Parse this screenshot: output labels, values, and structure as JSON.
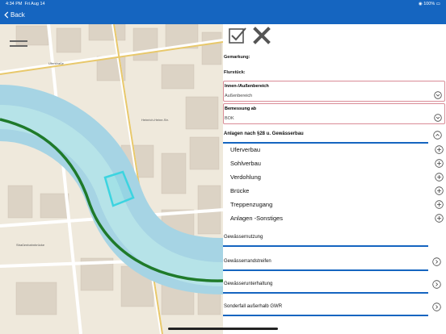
{
  "status_bar": {
    "time": "4:34 PM",
    "date": "Fri Aug 14",
    "battery": "100%"
  },
  "nav": {
    "back_label": "Back"
  },
  "map": {
    "street_labels": [
      "Uferstraße",
      "Heinrich-Heine-Str.",
      "Straßenbahnbrücke"
    ],
    "colors": {
      "river": "#a6d4e4",
      "river_band": "#b6e3e8",
      "river_outline": "#1f7a2a",
      "parcel_highlight": "#3cd4e0",
      "road": "#ffffff",
      "building": "#dcd3c5"
    }
  },
  "toolbar": {
    "confirm_icon": "checkbox-icon",
    "cancel_icon": "close-icon"
  },
  "form": {
    "gemarkung_label": "Gemarkung:",
    "flurstueck_label": "Flurstück:",
    "innen_aussen": {
      "label": "Innen-/Außenbereich",
      "value": "Außenbereich"
    },
    "bemessung": {
      "label": "Bemessung ab",
      "value": "BOK"
    },
    "anlagen_section": {
      "title": "Anlagen nach §28 u. Gewässerbau",
      "items": [
        "Uferverbau",
        "Sohlverbau",
        "Verdohlung",
        "Brücke",
        "Treppenzugang",
        "Anlagen  -Sonstiges"
      ]
    },
    "sections": [
      "Gewässernutzung",
      "Gewässerrandstreifen",
      "Gewässerunterhaltung",
      "Sonderfall außerhalb GWR"
    ]
  }
}
